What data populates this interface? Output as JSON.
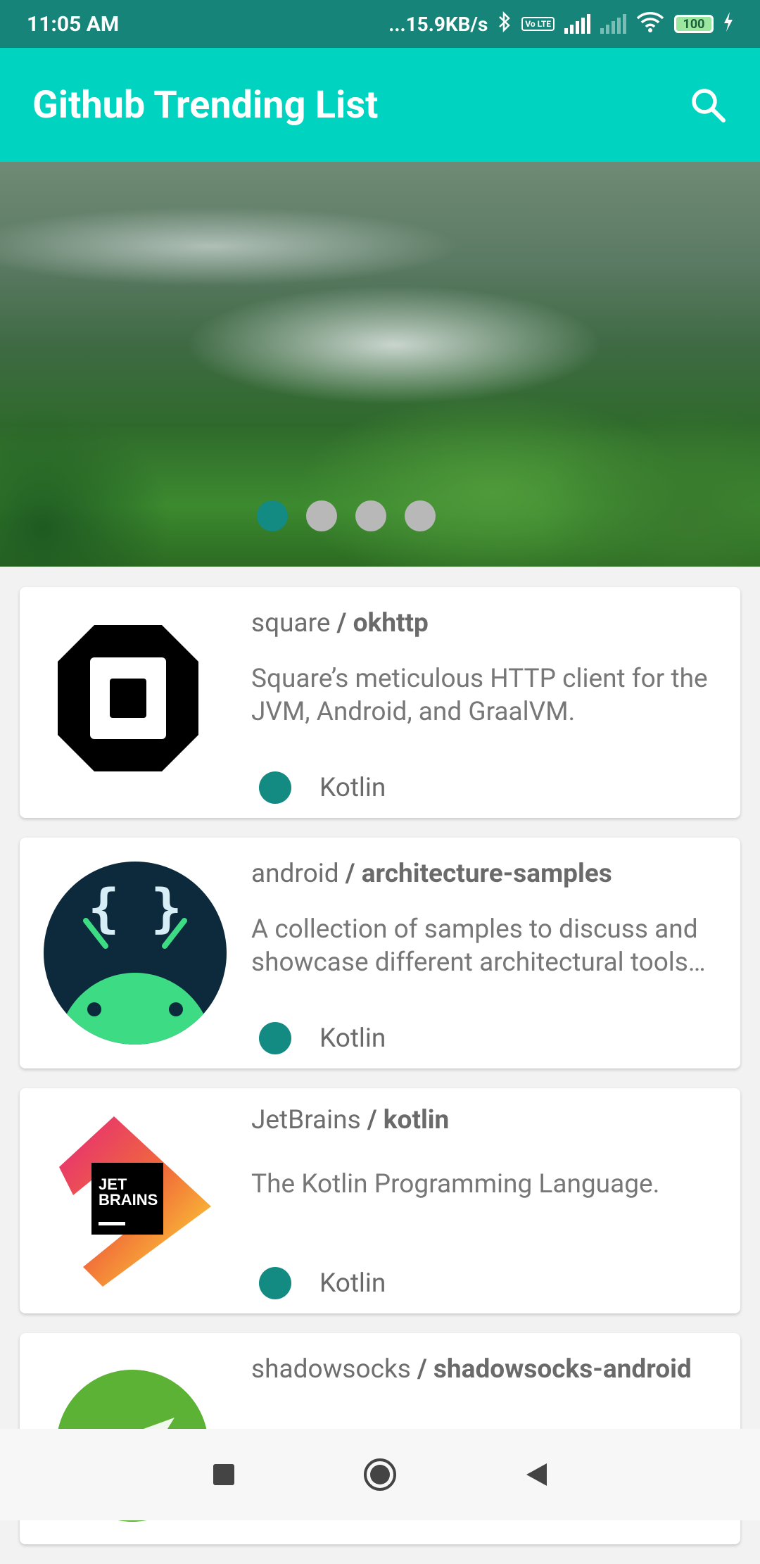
{
  "status_bar": {
    "time": "11:05 AM",
    "network_speed": "...15.9KB/s",
    "battery": "100",
    "volte": "Vo LTE"
  },
  "app_bar": {
    "title": "Github Trending List",
    "search_icon": "search-icon"
  },
  "banner": {
    "page_count": 4,
    "active_page": 1
  },
  "repos": [
    {
      "owner": "square",
      "separator": " / ",
      "name": "okhttp",
      "description": "Square’s meticulous HTTP client for the JVM, Android, and GraalVM.",
      "language": "Kotlin",
      "logo": "square-logo"
    },
    {
      "owner": "android",
      "separator": " / ",
      "name": "architecture-samples",
      "description": "A collection of samples to discuss and showcase different architectural tools and patterns for Android apps.",
      "language": "Kotlin",
      "logo": "android-logo"
    },
    {
      "owner": "JetBrains",
      "separator": " / ",
      "name": "kotlin",
      "description": "The Kotlin Programming Language.",
      "language": "Kotlin",
      "logo": "jetbrains-logo"
    },
    {
      "owner": "shadowsocks",
      "separator": " / ",
      "name": "shadowsocks-android",
      "logo": "shadowsocks-logo"
    }
  ],
  "jetbrains_logo_text": {
    "line1": "JET",
    "line2": "BRAINS"
  },
  "android_logo_braces": "{ }",
  "colors": {
    "accent": "#00d4c0",
    "status_bar": "#178479",
    "language_dot": "#138a82"
  }
}
